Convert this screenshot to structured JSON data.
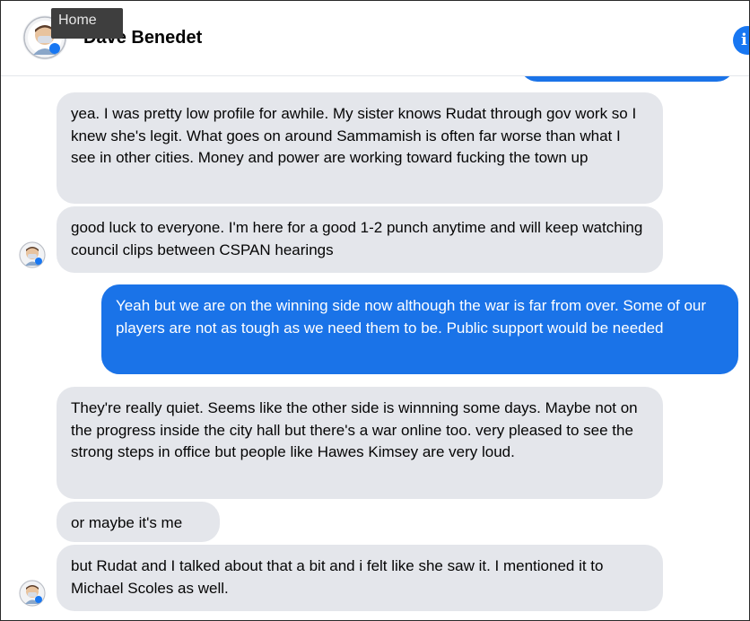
{
  "header": {
    "contact_name": "Dave Benedet",
    "tooltip": "Home",
    "info_icon": "info-icon"
  },
  "colors": {
    "incoming_bubble": "#e4e6eb",
    "outgoing_bubble": "#1a73e8",
    "text": "#050505"
  },
  "messages": [
    {
      "side": "incoming",
      "text": "yea. I was pretty low profile for awhile. My sister knows Rudat through gov work so I knew she's legit. What goes on around Sammamish is often far worse than what I see in other cities. Money and power are working toward fucking the town up"
    },
    {
      "side": "incoming",
      "text": "good luck to everyone. I'm here for a good 1-2 punch anytime and will keep watching council clips between CSPAN hearings"
    },
    {
      "side": "outgoing",
      "text": "Yeah but we are on the winning side now although the war is far from over. Some of our players are not as tough as we need them to be.  Public support would be needed"
    },
    {
      "side": "incoming",
      "text": "They're really quiet. Seems like the other side is winnning some days. Maybe not on the progress inside the city hall but there's a war online too. very pleased to see the strong steps in office but people like Hawes Kimsey are very loud."
    },
    {
      "side": "incoming",
      "text": "or maybe it's me"
    },
    {
      "side": "incoming",
      "text": "but Rudat and I talked about that a bit and i felt like she saw it. I mentioned it to Michael Scoles as well."
    }
  ]
}
